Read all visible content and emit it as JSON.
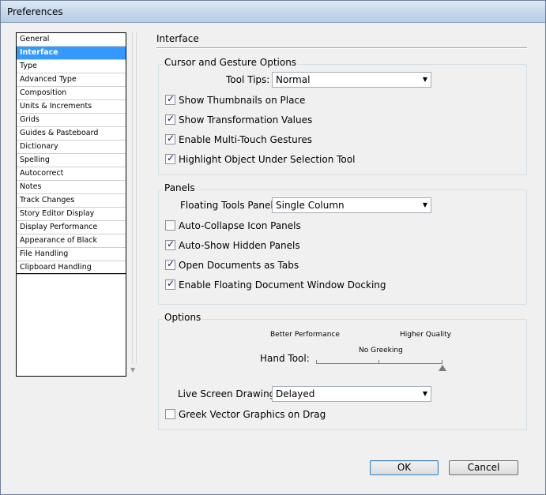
{
  "window": {
    "title": "Preferences"
  },
  "sidebar": {
    "items": [
      {
        "label": "General",
        "selected": false
      },
      {
        "label": "Interface",
        "selected": true
      },
      {
        "label": "Type",
        "selected": false
      },
      {
        "label": "Advanced Type",
        "selected": false
      },
      {
        "label": "Composition",
        "selected": false
      },
      {
        "label": "Units & Increments",
        "selected": false
      },
      {
        "label": "Grids",
        "selected": false
      },
      {
        "label": "Guides & Pasteboard",
        "selected": false
      },
      {
        "label": "Dictionary",
        "selected": false
      },
      {
        "label": "Spelling",
        "selected": false
      },
      {
        "label": "Autocorrect",
        "selected": false
      },
      {
        "label": "Notes",
        "selected": false
      },
      {
        "label": "Track Changes",
        "selected": false
      },
      {
        "label": "Story Editor Display",
        "selected": false
      },
      {
        "label": "Display Performance",
        "selected": false
      },
      {
        "label": "Appearance of Black",
        "selected": false
      },
      {
        "label": "File Handling",
        "selected": false
      },
      {
        "label": "Clipboard Handling",
        "selected": false
      }
    ]
  },
  "main": {
    "title": "Interface",
    "cursor": {
      "label": "Cursor and Gesture Options",
      "tooltips_label": "Tool Tips:",
      "tooltips_value": "Normal",
      "checks": [
        {
          "label": "Show Thumbnails on Place",
          "checked": true
        },
        {
          "label": "Show Transformation Values",
          "checked": true
        },
        {
          "label": "Enable Multi-Touch Gestures",
          "checked": true
        },
        {
          "label": "Highlight Object Under Selection Tool",
          "checked": true
        }
      ]
    },
    "panels": {
      "label": "Panels",
      "floating_label": "Floating Tools Panel:",
      "floating_value": "Single Column",
      "checks": [
        {
          "label": "Auto-Collapse Icon Panels",
          "checked": false
        },
        {
          "label": "Auto-Show Hidden Panels",
          "checked": true
        },
        {
          "label": "Open Documents as Tabs",
          "checked": true
        },
        {
          "label": "Enable Floating Document Window Docking",
          "checked": true
        }
      ]
    },
    "options": {
      "label": "Options",
      "better_performance": "Better Performance",
      "higher_quality": "Higher Quality",
      "no_greeking": "No Greeking",
      "hand_tool_label": "Hand Tool:",
      "hand_tool_level": 1.0,
      "live_label": "Live Screen Drawing:",
      "live_value": "Delayed",
      "greek_vector": {
        "label": "Greek Vector Graphics on Drag",
        "checked": false
      }
    }
  },
  "buttons": {
    "ok": "OK",
    "cancel": "Cancel"
  }
}
